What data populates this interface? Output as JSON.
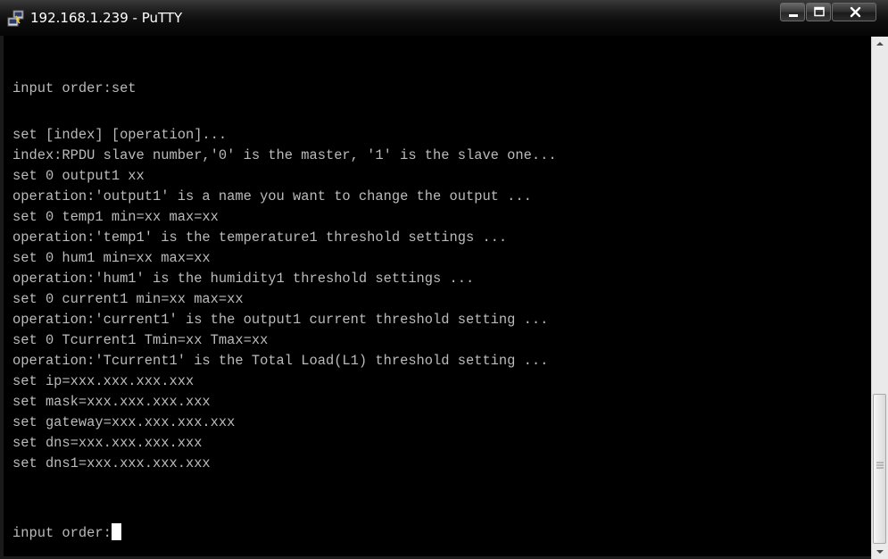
{
  "window": {
    "title": "192.168.1.239 - PuTTY"
  },
  "icons": {
    "app": "putty-icon",
    "minimize": "minimize-icon",
    "maximize": "maximize-icon",
    "close": "close-icon",
    "scroll_up": "arrow-up-icon",
    "scroll_down": "arrow-down-icon"
  },
  "terminal": {
    "lines": [
      "input order:set",
      "",
      "set [index] [operation]...",
      "index:RPDU slave number,'0' is the master, '1' is the slave one...",
      "set 0 output1 xx",
      "operation:'output1' is a name you want to change the output ...",
      "set 0 temp1 min=xx max=xx",
      "operation:'temp1' is the temperature1 threshold settings ...",
      "set 0 hum1 min=xx max=xx",
      "operation:'hum1' is the humidity1 threshold settings ...",
      "set 0 current1 min=xx max=xx",
      "operation:'current1' is the output1 current threshold setting ...",
      "set 0 Tcurrent1 Tmin=xx Tmax=xx",
      "operation:'Tcurrent1' is the Total Load(L1) threshold setting ...",
      "set ip=xxx.xxx.xxx.xxx",
      "set mask=xxx.xxx.xxx.xxx",
      "set gateway=xxx.xxx.xxx.xxx",
      "set dns=xxx.xxx.xxx.xxx",
      "set dns1=xxx.xxx.xxx.xxx"
    ],
    "prompt": "input order:"
  },
  "colors": {
    "terminal_bg": "#000000",
    "terminal_fg": "#bbbbbb",
    "cursor": "#ffffff"
  }
}
